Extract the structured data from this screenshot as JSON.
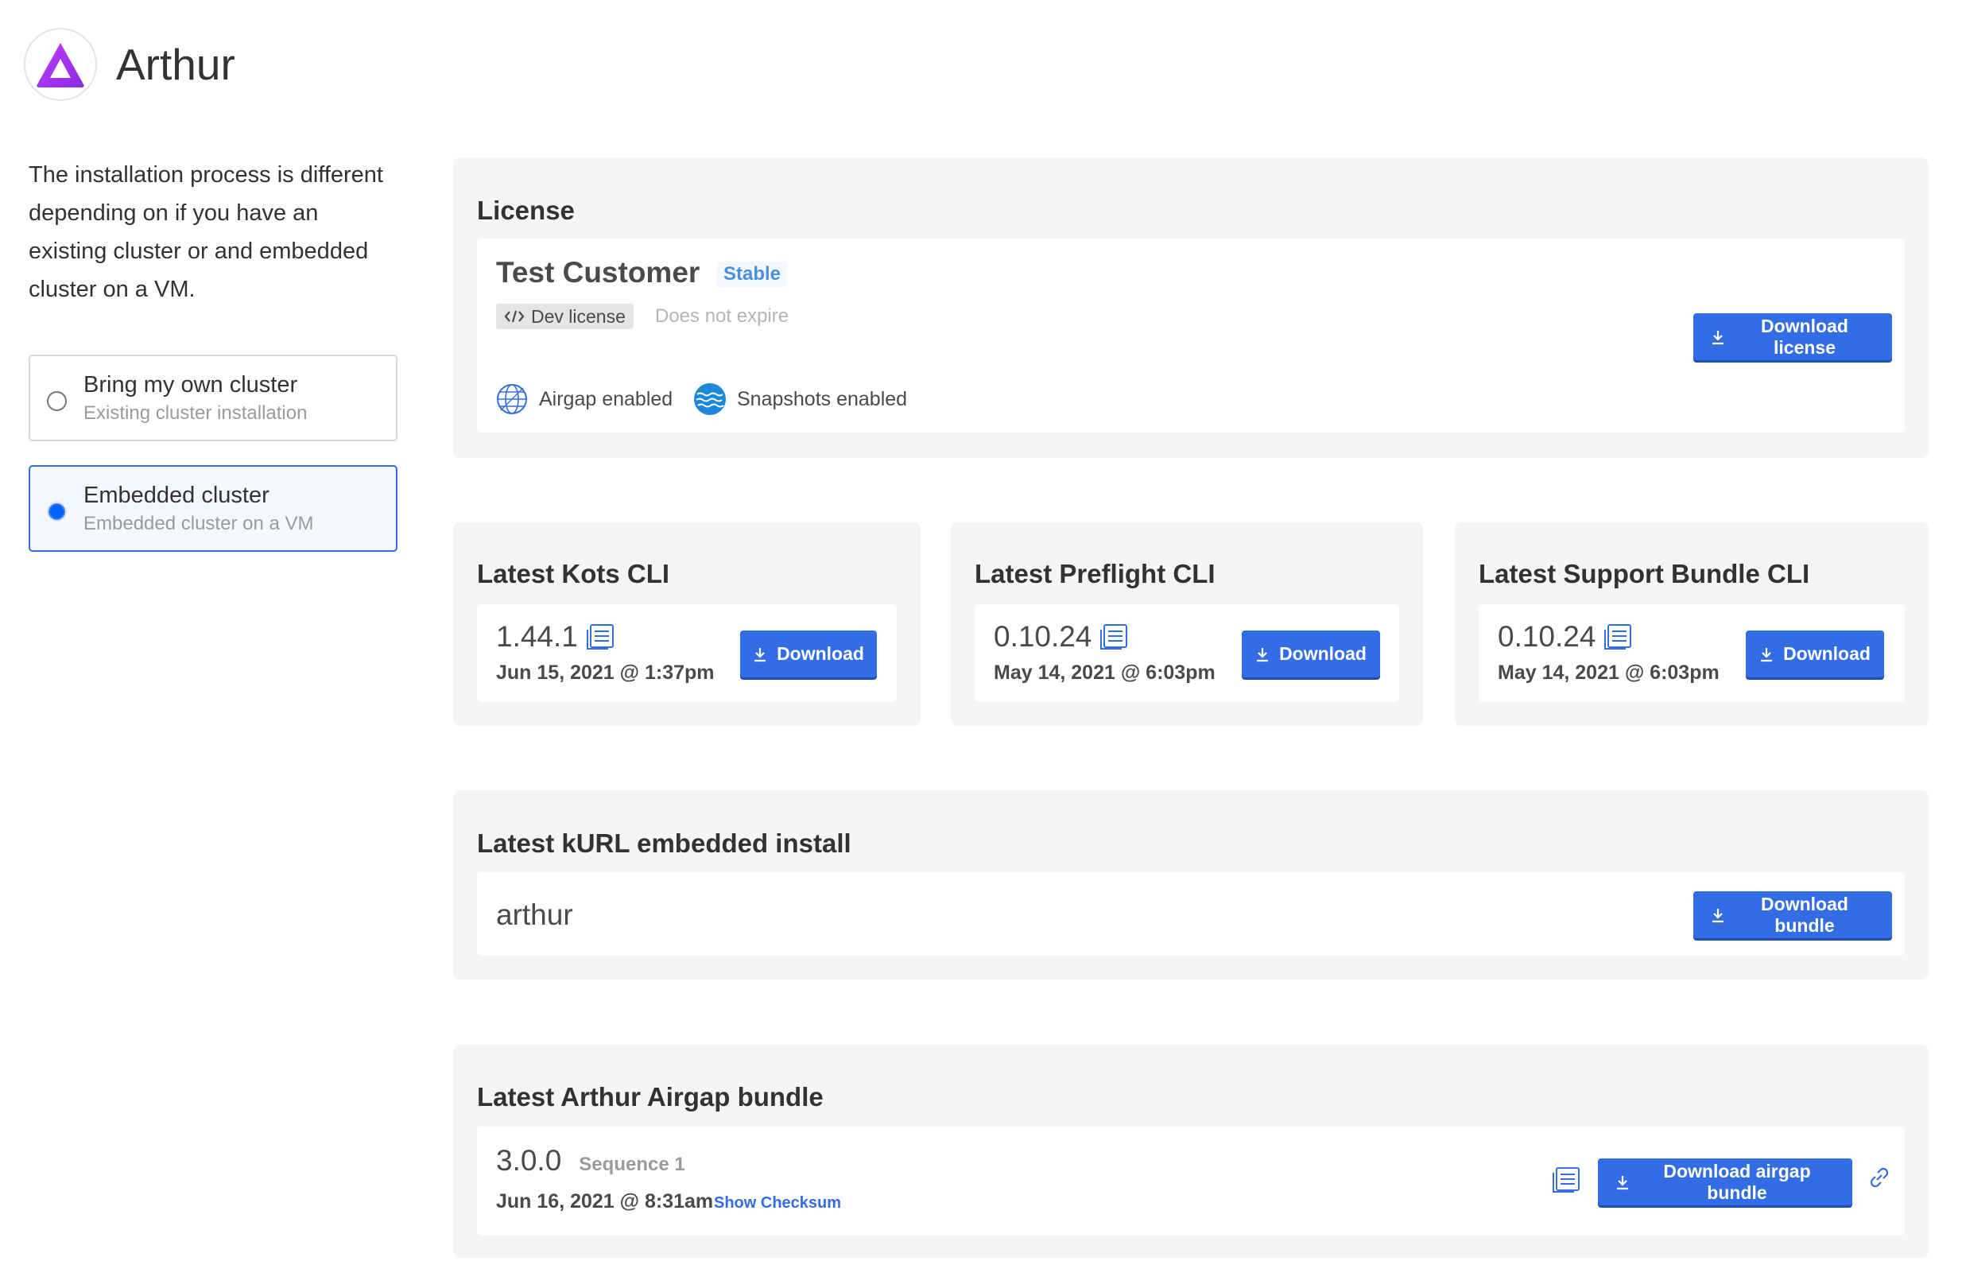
{
  "app": {
    "title": "Arthur",
    "logo_icon": "triangle-logo-icon",
    "brand_color": "#a12fff"
  },
  "sidebar": {
    "description": "The installation process is different depending on if you have an existing cluster or and embedded cluster on a VM.",
    "options": [
      {
        "title": "Bring my own cluster",
        "subtitle": "Existing cluster installation",
        "selected": false
      },
      {
        "title": "Embedded cluster",
        "subtitle": "Embedded cluster on a VM",
        "selected": true
      }
    ]
  },
  "license": {
    "section_title": "License",
    "customer": "Test Customer",
    "channel_badge": "Stable",
    "license_type": "Dev license",
    "expiry": "Does not expire",
    "features": [
      {
        "icon": "globe-icon",
        "label": "Airgap enabled"
      },
      {
        "icon": "waves-icon",
        "label": "Snapshots enabled"
      }
    ],
    "download_label": "Download license"
  },
  "clis": [
    {
      "title": "Latest Kots CLI",
      "version": "1.44.1",
      "date": "Jun 15, 2021 @ 1:37pm",
      "download_label": "Download"
    },
    {
      "title": "Latest Preflight CLI",
      "version": "0.10.24",
      "date": "May 14, 2021 @ 6:03pm",
      "download_label": "Download"
    },
    {
      "title": "Latest Support Bundle CLI",
      "version": "0.10.24",
      "date": "May 14, 2021 @ 6:03pm",
      "download_label": "Download"
    }
  ],
  "kurl": {
    "section_title": "Latest kURL embedded install",
    "name": "arthur",
    "download_label": "Download bundle"
  },
  "airgap": {
    "section_title": "Latest Arthur Airgap bundle",
    "version": "3.0.0",
    "sequence": "Sequence 1",
    "date": "Jun 16, 2021 @ 8:31am",
    "checksum_link": "Show Checksum",
    "download_label": "Download airgap bundle"
  },
  "colors": {
    "primary_button": "#326de6",
    "badge_text": "#4a90e2",
    "link": "#326de6",
    "panel_bg": "#f5f5f5"
  }
}
